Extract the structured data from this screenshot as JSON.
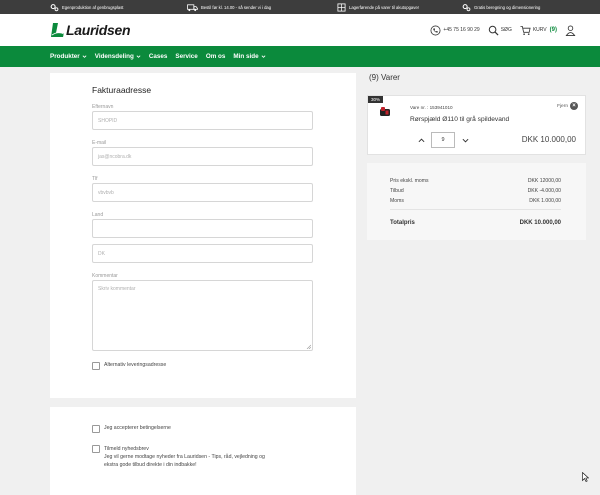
{
  "topbar": {
    "usps": [
      {
        "icon": "gears-icon",
        "text": "Egenproduktion af genbrugsplast"
      },
      {
        "icon": "truck-icon",
        "text": "Bestil før kl. 14.00 - så sender vi i dag"
      },
      {
        "icon": "warehouse-icon",
        "text": "Lagerførende på varer til akutopgaver"
      },
      {
        "icon": "calculator-icon",
        "text": "Gratis beregning og dimensionering"
      }
    ]
  },
  "header": {
    "logo_text": "Lauridsen",
    "phone": "+45 75 16 90 29",
    "search_label": "SØG",
    "cart_label": "KURV",
    "cart_count": "(9)"
  },
  "nav": {
    "items": [
      {
        "label": "Produkter",
        "dropdown": true
      },
      {
        "label": "Vidensdeling",
        "dropdown": true
      },
      {
        "label": "Cases",
        "dropdown": false
      },
      {
        "label": "Service",
        "dropdown": false
      },
      {
        "label": "Om os",
        "dropdown": false
      },
      {
        "label": "Min side",
        "dropdown": true
      }
    ]
  },
  "billing": {
    "title": "Fakturaadresse",
    "fields": [
      {
        "label": "Efternavn",
        "value": "SHOPID"
      },
      {
        "label": "E-mail",
        "value": "jas@ncobra.dk"
      },
      {
        "label": "Tlf",
        "value": "vbvbvb"
      },
      {
        "label": "Land",
        "value": ""
      },
      {
        "label": "",
        "value": "DK"
      }
    ],
    "comment_label": "Kommentar",
    "comment_placeholder": "Skriv kommentar",
    "alt_delivery_label": "Alternativ leveringsadresse"
  },
  "terms": {
    "accept_label": "Jeg accepterer betingelserne",
    "newsletter_title": "Tilmeld nyhedsbrev",
    "newsletter_text_1": "Jeg vil gerne modtage nyheder fra Lauridsen - Tips, råd, vejledning og",
    "newsletter_text_2": "ekstra gode tilbud direkte i din indbakke!"
  },
  "cart": {
    "heading": "(9) Varer",
    "item": {
      "discount_badge": "30%",
      "varenr_label": "Vare nr. :",
      "varenr": "153941010",
      "name": "Rørspjæld Ø110 til grå spildevand",
      "remove_label": "Fjern",
      "quantity": "9",
      "price": "DKK 10.000,00"
    },
    "totals": {
      "rows": [
        {
          "label": "Pris ekskl. moms",
          "value": "DKK 12000,00"
        },
        {
          "label": "Tilbud",
          "value": "DKK -4.000,00"
        },
        {
          "label": "Moms",
          "value": "DKK 1.000,00"
        }
      ],
      "total_label": "Totalpris",
      "total_value": "DKK 10.000,00"
    }
  },
  "colors": {
    "brand_green": "#0b8a3c",
    "topbar": "#3d3d3d"
  }
}
